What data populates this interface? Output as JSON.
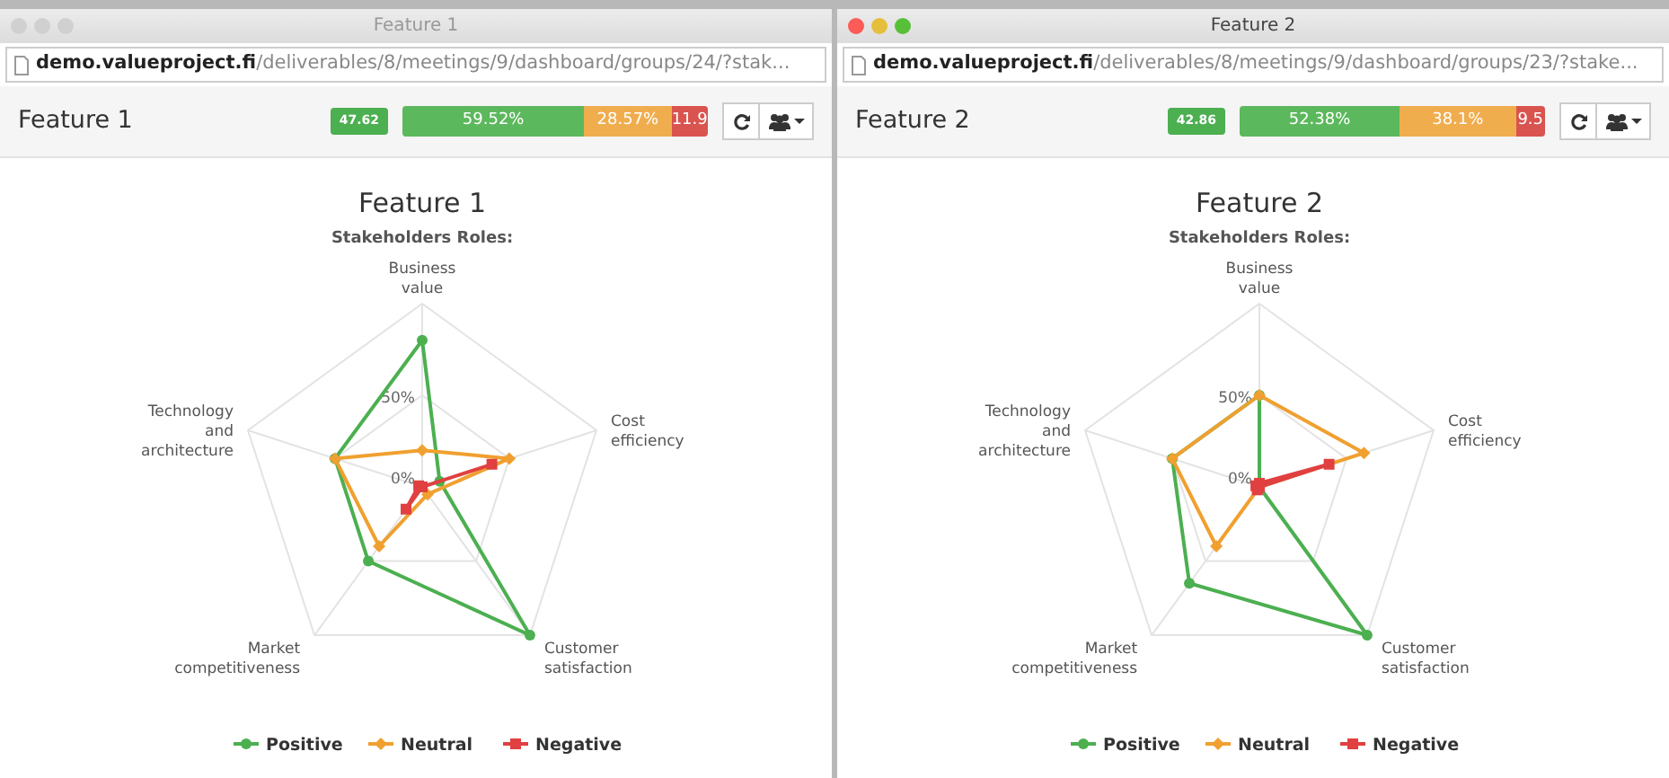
{
  "windows": [
    {
      "title": "Feature 1",
      "traffic_lights_active": false,
      "url": "**demo.valueproject.fi**/deliverables/8/meetings/9/dashboard/groups/24/?stak...",
      "header": {
        "title": "Feature 1",
        "score_badge": "47.62",
        "segments": [
          {
            "kind": "positive",
            "label": "59.52%"
          },
          {
            "kind": "neutral",
            "label": "28.57%"
          },
          {
            "kind": "negative",
            "label": "11.9"
          }
        ]
      },
      "chart": {
        "title": "Feature 1",
        "subtitle": "Stakeholders Roles:",
        "axis_labels": [
          "Business value",
          "Technology and architecture",
          "Cost efficiency",
          "Market competitiveness",
          "Customer satisfaction"
        ],
        "ring_labels": [
          "50%",
          "0%"
        ],
        "legend": [
          {
            "name": "Positive",
            "color": "#4caf50"
          },
          {
            "name": "Neutral",
            "color": "#f0a030"
          },
          {
            "name": "Negative",
            "color": "#e04040"
          }
        ]
      }
    },
    {
      "title": "Feature 2",
      "traffic_lights_active": true,
      "url": "**demo.valueproject.fi**/deliverables/8/meetings/9/dashboard/groups/23/?stake...",
      "header": {
        "title": "Feature 2",
        "score_badge": "42.86",
        "segments": [
          {
            "kind": "positive",
            "label": "52.38%"
          },
          {
            "kind": "neutral",
            "label": "38.1%"
          },
          {
            "kind": "negative",
            "label": "9.5"
          }
        ]
      },
      "chart": {
        "title": "Feature 2",
        "subtitle": "Stakeholders Roles:",
        "axis_labels": [
          "Business value",
          "Technology and architecture",
          "Cost efficiency",
          "Market competitiveness",
          "Customer satisfaction"
        ],
        "ring_labels": [
          "50%",
          "0%"
        ],
        "legend": [
          {
            "name": "Positive",
            "color": "#4caf50"
          },
          {
            "name": "Neutral",
            "color": "#f0a030"
          },
          {
            "name": "Negative",
            "color": "#e04040"
          }
        ]
      }
    }
  ]
}
